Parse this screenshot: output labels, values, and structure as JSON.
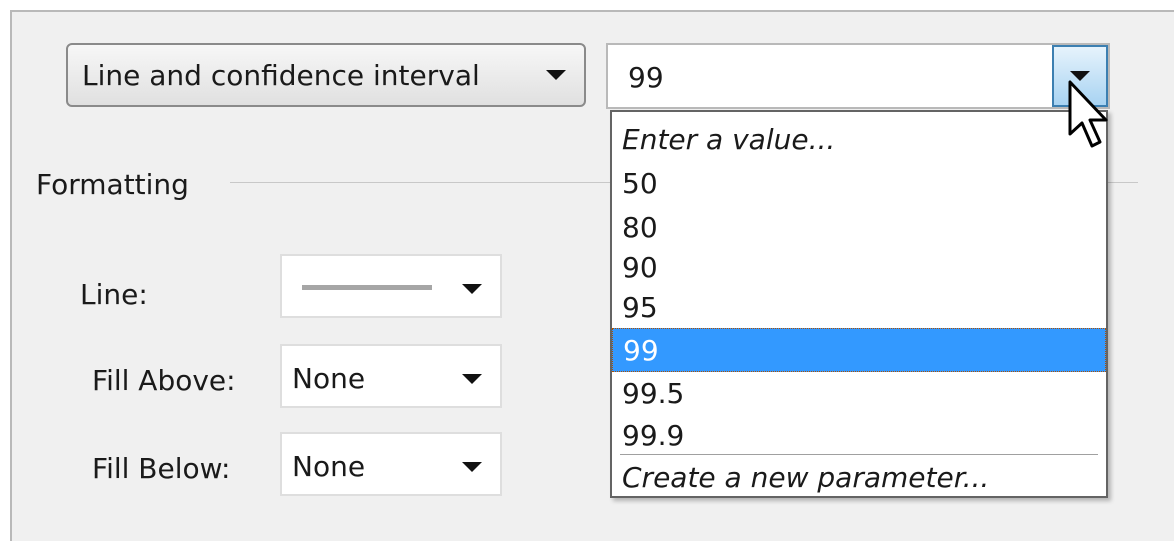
{
  "chart_type_combo": {
    "value": "Line and confidence interval"
  },
  "confidence_field": {
    "value": "99"
  },
  "section": {
    "title": "Formatting"
  },
  "formatting_rows": {
    "line": {
      "label": "Line:"
    },
    "fill_above": {
      "label": "Fill Above:",
      "value": "None"
    },
    "fill_below": {
      "label": "Fill Below:",
      "value": "None"
    }
  },
  "dropdown": {
    "options": [
      "Enter a value...",
      "50",
      "80",
      "90",
      "95",
      "99",
      "99.5",
      "99.9",
      "Create a new parameter..."
    ],
    "selected": "99"
  },
  "colors": {
    "selection": "#3399ff",
    "drop_button": "#a8d3f2"
  }
}
